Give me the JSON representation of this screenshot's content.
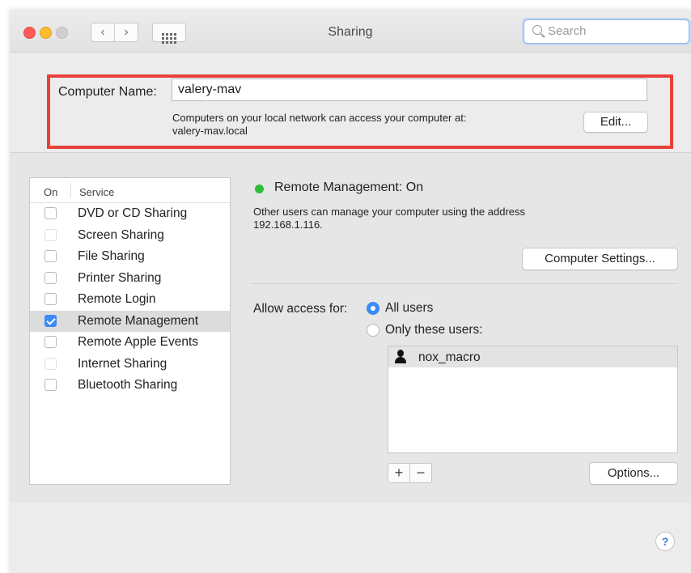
{
  "window": {
    "title": "Sharing"
  },
  "toolbar": {
    "back_glyph": "‹",
    "forward_glyph": "›",
    "search_placeholder": "Search",
    "icons": [
      "back-icon",
      "forward-icon",
      "show-all-grid-icon",
      "search-icon"
    ]
  },
  "computer_name": {
    "label": "Computer Name:",
    "value": "valery-mav",
    "help_line1": "Computers on your local network can access your computer at:",
    "help_line2": "valery-mav.local",
    "edit_label": "Edit...",
    "highlight_color": "#e8403b"
  },
  "services": {
    "col_on": "On",
    "col_service": "Service",
    "items": [
      {
        "label": "DVD or CD Sharing",
        "checked": false
      },
      {
        "label": "Screen Sharing",
        "checked": false
      },
      {
        "label": "File Sharing",
        "checked": false
      },
      {
        "label": "Printer Sharing",
        "checked": false
      },
      {
        "label": "Remote Login",
        "checked": false
      },
      {
        "label": "Remote Management",
        "checked": true,
        "selected": true
      },
      {
        "label": "Remote Apple Events",
        "checked": false
      },
      {
        "label": "Internet Sharing",
        "checked": false
      },
      {
        "label": "Bluetooth Sharing",
        "checked": false
      }
    ]
  },
  "detail": {
    "status": "Remote Management: On",
    "status_color": "#2ebd3b",
    "desc_line1": "Other users can manage your computer using the address",
    "desc_line2": "192.168.1.116.",
    "computer_settings_label": "Computer Settings...",
    "access_label": "Allow access for:",
    "radio_all": "All users",
    "radio_only": "Only these users:",
    "selected_radio": "All users",
    "users": [
      "nox_macro"
    ],
    "plus": "+",
    "minus": "−",
    "options_label": "Options...",
    "help": "?"
  },
  "colors": {
    "accent": "#3b8af5"
  }
}
